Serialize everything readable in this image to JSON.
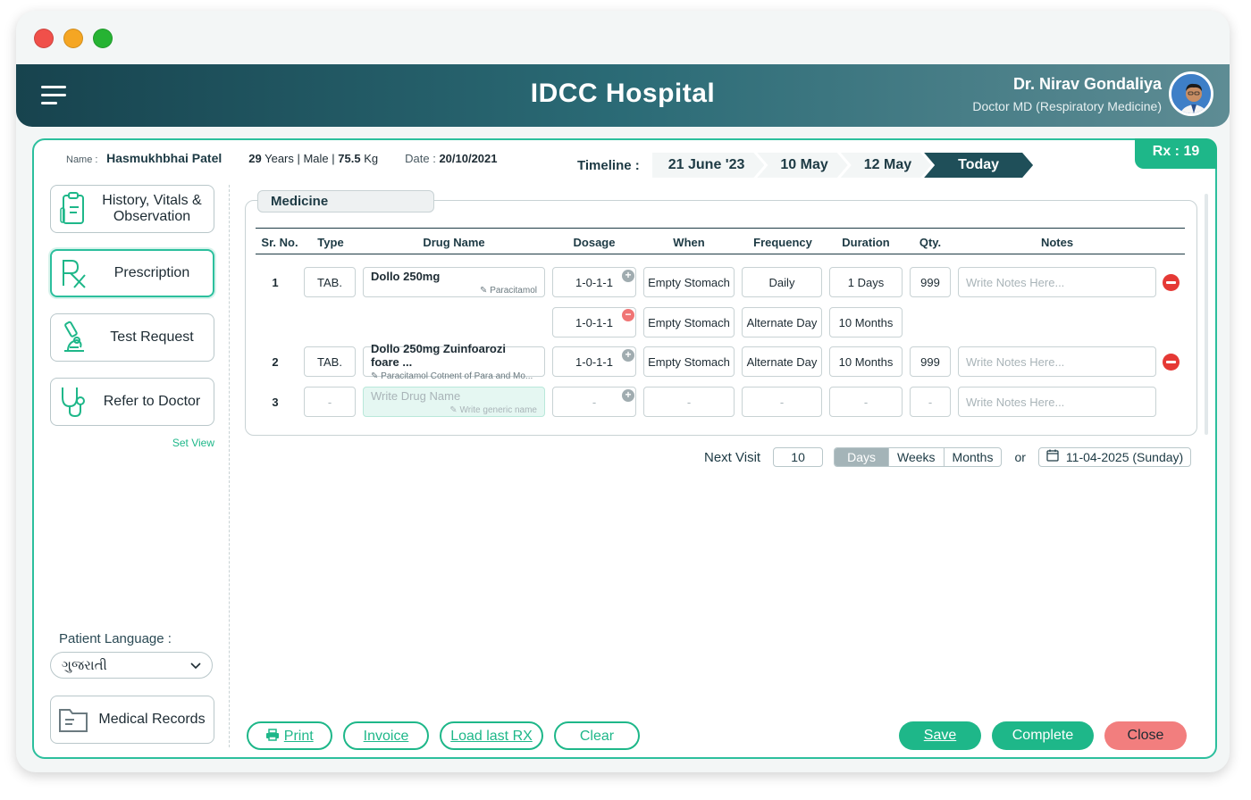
{
  "app": {
    "title": "IDCC Hospital",
    "doctor_name": "Dr. Nirav Gondaliya",
    "doctor_role": "Doctor MD (Respiratory Medicine)"
  },
  "patient": {
    "name_label": "Name :",
    "name": "Hasmukhbhai Patel",
    "age": "29",
    "age_unit": "Years | Male |",
    "weight": "75.5",
    "weight_unit": "Kg",
    "date_label": "Date :",
    "date": "20/10/2021"
  },
  "timeline": {
    "label": "Timeline :",
    "steps": [
      "21 June '23",
      "10 May",
      "12 May",
      "Today"
    ]
  },
  "rx": "Rx : 19",
  "sidebar": {
    "items": [
      {
        "label": "History, Vitals & Observation"
      },
      {
        "label": "Prescription"
      },
      {
        "label": "Test Request"
      },
      {
        "label": "Refer to Doctor"
      }
    ],
    "set_view": "Set View",
    "language_label": "Patient Language :",
    "language_value": "ગુજરાતી",
    "medical_records": "Medical Records"
  },
  "medicine": {
    "tab": "Medicine",
    "headers": [
      "Sr. No.",
      "Type",
      "Drug Name",
      "Dosage",
      "When",
      "Frequency",
      "Duration",
      "Qty.",
      "Notes"
    ],
    "notes_placeholder": "Write Notes Here...",
    "rows": [
      {
        "sr": "1",
        "type": "TAB.",
        "drug": "Dollo 250mg",
        "generic": "Paracitamol",
        "dosage": "1-0-1-1",
        "when": "Empty Stomach",
        "frequency": "Daily",
        "duration": "1 Days",
        "qty": "999"
      },
      {
        "dosage": "1-0-1-1",
        "when": "Empty Stomach",
        "frequency": "Alternate Day",
        "duration": "10 Months"
      },
      {
        "sr": "2",
        "type": "TAB.",
        "drug": "Dollo 250mg Zuinfoarozi foare ...",
        "generic": "Paracitamol Cotnent of Para and Mo...",
        "dosage": "1-0-1-1",
        "when": "Empty Stomach",
        "frequency": "Alternate Day",
        "duration": "10 Months",
        "qty": "999"
      },
      {
        "sr": "3",
        "type": "-",
        "drug_placeholder": "Write Drug Name",
        "generic_placeholder": "Write generic name",
        "dosage": "-",
        "when": "-",
        "frequency": "-",
        "duration": "-",
        "qty": "-"
      }
    ]
  },
  "next_visit": {
    "label": "Next Visit",
    "value": "10",
    "units": [
      "Days",
      "Weeks",
      "Months"
    ],
    "or": "or",
    "date": "11-04-2025 (Sunday)"
  },
  "footer": {
    "print": "Print",
    "invoice": "Invoice",
    "load_last_rx": "Load last RX",
    "clear": "Clear",
    "save": "Save",
    "complete": "Complete",
    "close": "Close"
  },
  "colors": {
    "accent": "#1eb789",
    "header_dark": "#17434e",
    "danger": "#e53935"
  }
}
